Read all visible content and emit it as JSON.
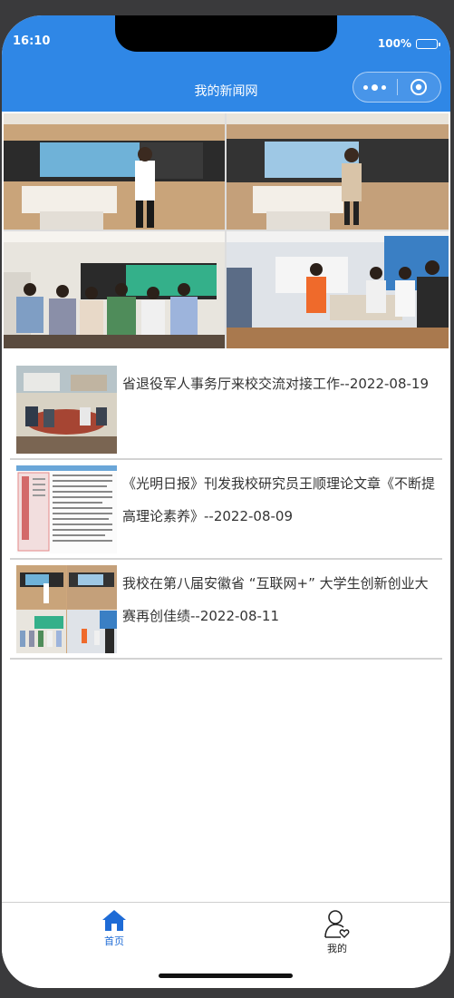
{
  "status_bar": {
    "time": "16:10",
    "battery": "100%"
  },
  "nav": {
    "title": "我的新闻网"
  },
  "carousel": {
    "dot_count": 3,
    "active_index": 2
  },
  "news": [
    {
      "title": "省退役军人事务厅来校交流对接工作--2022-08-19"
    },
    {
      "title": "《光明日报》刊发我校研究员王顺理论文章《不断提高理论素养》--2022-08-09"
    },
    {
      "title": "我校在第八届安徽省 “互联网+” 大学生创新创业大赛再创佳绩--2022-08-11"
    }
  ],
  "tabbar": {
    "home_label": "首页",
    "mine_label": "我的",
    "active_color": "#1e6bd6"
  },
  "colors": {
    "accent": "#2f87e6"
  }
}
